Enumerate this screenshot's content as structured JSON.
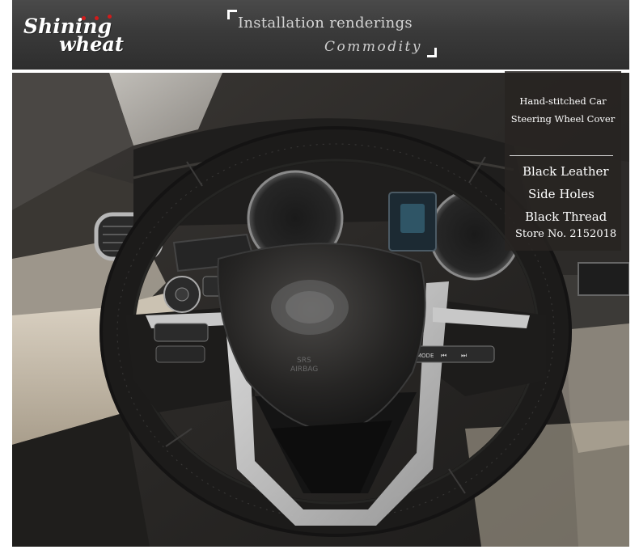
{
  "brand": {
    "logo_line1": "Shining",
    "logo_line2": "wheat"
  },
  "header": {
    "installation_label": "Installation renderings",
    "commodity_label": "Commodity"
  },
  "overlay": {
    "title_line1": "Hand-stitched Car",
    "title_line2": "Steering Wheel Cover",
    "material": "Black Leather",
    "holes": "Side Holes",
    "thread": "Black Thread",
    "store": "Store No. 2152018"
  },
  "photo": {
    "airbag_text_1": "SRS",
    "airbag_text_2": "AIRBAG",
    "button_mode": "MODE"
  },
  "colors": {
    "banner": "#3a3a3a",
    "leather": "#1e1d1c",
    "trim": "#c9c9c9",
    "dash": "#2b2927"
  }
}
